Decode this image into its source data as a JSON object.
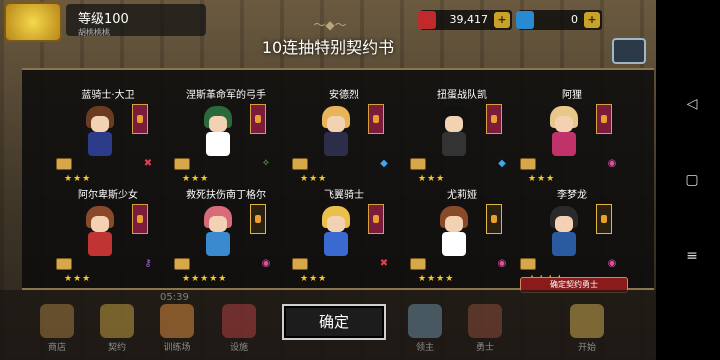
{
  "hud": {
    "level": "等级100",
    "player_name": "胡桃桃桃",
    "gold": "39,417",
    "gems": "0"
  },
  "title": "10连抽特别契约书",
  "cards": [
    {
      "name": "蓝骑士·大卫",
      "stars": "★★★",
      "element": "✖",
      "hair": "#6b3b22",
      "body": "#2c3c8a",
      "elem_color": "#e04050"
    },
    {
      "name": "涅斯革命军的弓手",
      "stars": "★★★",
      "element": "✧",
      "hair": "#2a6a3a",
      "body": "#ffffff",
      "elem_color": "#60d060"
    },
    {
      "name": "安德烈",
      "stars": "★★★",
      "element": "◆",
      "hair": "#e8b45a",
      "body": "#2d2d4a",
      "elem_color": "#40a8f0"
    },
    {
      "name": "扭蛋战队凯",
      "stars": "★★★",
      "element": "◆",
      "hair": "#111111",
      "body": "#333333",
      "elem_color": "#40a8f0"
    },
    {
      "name": "阿狸",
      "stars": "★★★",
      "element": "◉",
      "hair": "#e8c88a",
      "body": "#c0336a",
      "elem_color": "#e050a0"
    },
    {
      "name": "阿尔卑斯少女",
      "stars": "★★★",
      "element": "⚷",
      "hair": "#8a4a2a",
      "body": "#c03434",
      "elem_color": "#a060e0"
    },
    {
      "name": "救死扶伤南丁格尔",
      "stars": "★★★★★",
      "element": "◉",
      "hair": "#d86a7a",
      "body": "#3a8ad0",
      "elem_color": "#e050a0"
    },
    {
      "name": "飞翼骑士",
      "stars": "★★★",
      "element": "✖",
      "hair": "#e8c04a",
      "body": "#3a6ad0",
      "elem_color": "#e04050"
    },
    {
      "name": "尤莉娅",
      "stars": "★★★★",
      "element": "◉",
      "hair": "#8a4a2a",
      "body": "#ffffff",
      "elem_color": "#e050a0"
    },
    {
      "name": "李梦龙",
      "stars": "★★★★",
      "element": "◉",
      "hair": "#2a2a2a",
      "body": "#2a5aa0",
      "elem_color": "#e050a0"
    }
  ],
  "confirm_badge": "确定契约勇士",
  "confirm_label": "确定",
  "timer": "05:39",
  "nav": [
    {
      "label": "商店",
      "color": "#a07a40"
    },
    {
      "label": "契约",
      "color": "#c09a40"
    },
    {
      "label": "训练场",
      "color": "#d88a40"
    },
    {
      "label": "设施",
      "color": "#b04040"
    },
    {
      "label": "",
      "color": "#7a6a50"
    },
    {
      "label": "",
      "color": "#7a6a50"
    },
    {
      "label": "领主",
      "color": "#6a8aa0"
    },
    {
      "label": "勇士",
      "color": "#8a4a3a"
    },
    {
      "label": "开始",
      "color": "#c8a850"
    }
  ],
  "system_nav": {
    "back": "◁",
    "home": "▢",
    "menu": "≡"
  }
}
